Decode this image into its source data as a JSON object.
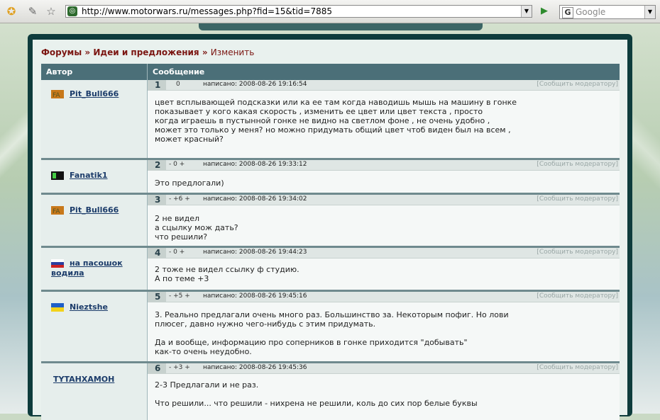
{
  "browser": {
    "url": "http://www.motorwars.ru/messages.php?fid=15&tid=7885",
    "search_placeholder": "Google",
    "drop": "▼",
    "go": "▶",
    "g": "G"
  },
  "breadcrumb": {
    "forums": "Форумы",
    "sep1": "»",
    "section": "Идеи и предложения",
    "sep2": "»",
    "current": "Изменить"
  },
  "table": {
    "col_author": "Автор",
    "col_message": "Сообщение"
  },
  "report_label": "[Сообщить модератору]",
  "posts": [
    {
      "num": "1",
      "vote": "0",
      "date": "написано: 2008-08-26 19:16:54",
      "author": "Pit_Bull666",
      "text": "цвет всплывающей подсказки или ка ее там когда наводишь мышь на машину в гонке\nпоказывает у кого какая скорость , изменить ее цвет или цвет текста , просто\nкогда играешь в пустынной гонке не видно на светлом фоне , не очень удобно ,\nможет это только у меня? но можно придумать общий цвет чтоб виден был на всем ,\nможет красный?"
    },
    {
      "num": "2",
      "vote": "- 0 +",
      "date": "написано: 2008-08-26 19:33:12",
      "author": "Fanatik1",
      "text": "Это предлогали)"
    },
    {
      "num": "3",
      "vote": "- +6 +",
      "date": "написано: 2008-08-26 19:34:02",
      "author": "Pit_Bull666",
      "text": "2 не видел\nа сцылку мож дать?\nчто решили?"
    },
    {
      "num": "4",
      "vote": "- 0 +",
      "date": "написано: 2008-08-26 19:44:23",
      "author": "на пасошок\nводила",
      "text": "2 тоже не видел ссылку ф студию.\nА по теме +3"
    },
    {
      "num": "5",
      "vote": "- +5 +",
      "date": "написано: 2008-08-26 19:45:16",
      "author": "Nieztshe",
      "text": "3. Реально предлагали очень много раз. Большинство за. Некоторым пофиг. Но лови\nплюсег, давно нужно чего-нибудь с этим придумать.\n\nДа и вообще, информацию про соперников в гонке приходится \"добывать\"\nкак-то очень неудобно."
    },
    {
      "num": "6",
      "vote": "- +3 +",
      "date": "написано: 2008-08-26 19:45:36",
      "author": "TYTAHXAMOH",
      "text": "2-3 Предлагали и не раз.\n\nЧто решили... что решили - нихрена не решили, коль до сих пор белые буквы"
    }
  ],
  "colors": {
    "header_bg": "#4b6f78",
    "breadcrumb": "#7b1612",
    "username": "#1c3c6a"
  }
}
